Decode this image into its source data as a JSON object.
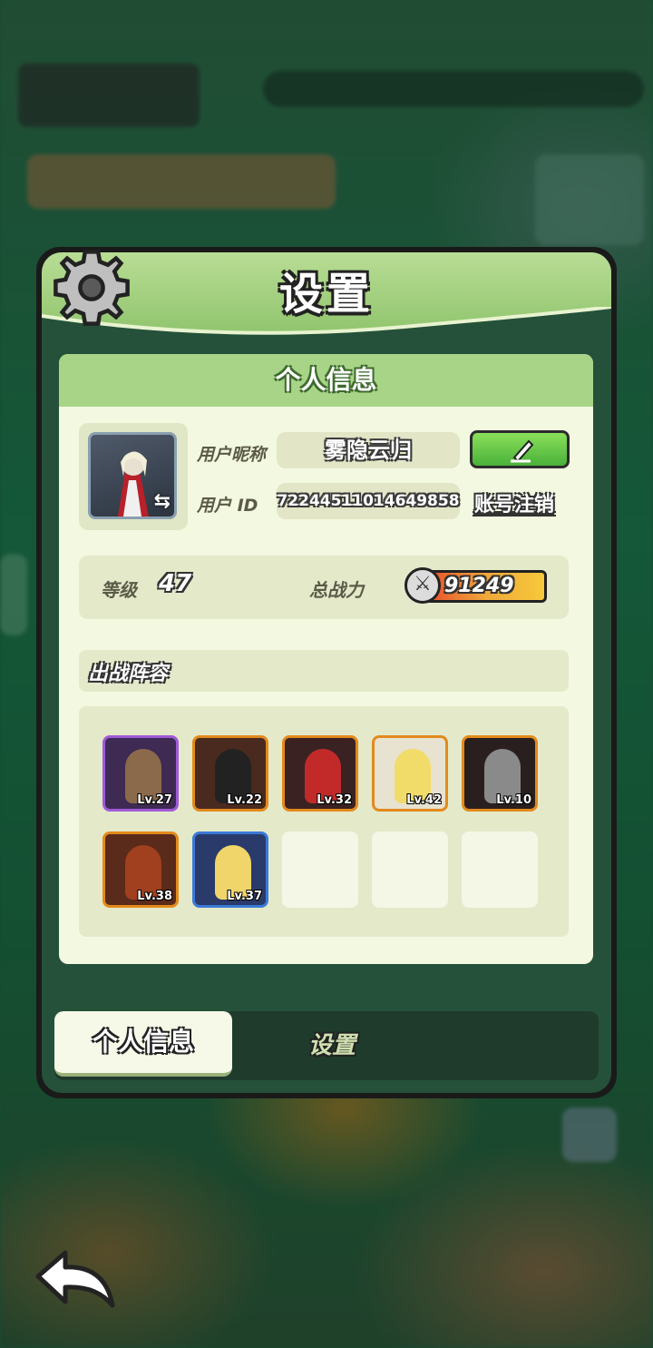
{
  "header": {
    "title": "设置"
  },
  "card": {
    "title": "个人信息",
    "nickname_label": "用户昵称",
    "nickname_value": "雾隐云归",
    "id_label": "用户  ID",
    "id_value": "72244511014649858",
    "cancel_account_label": "账号注销"
  },
  "stats": {
    "level_label": "等级",
    "level_value": "47",
    "power_label": "总战力",
    "power_value": "91249"
  },
  "lineup": {
    "title": "出战阵容",
    "heroes": [
      {
        "level": "Lv.27",
        "border": "#a05ad8"
      },
      {
        "level": "Lv.22",
        "border": "#e38a1c"
      },
      {
        "level": "Lv.32",
        "border": "#e38a1c"
      },
      {
        "level": "Lv.42",
        "border": "#e38a1c"
      },
      {
        "level": "Lv.10",
        "border": "#e38a1c"
      },
      {
        "level": "Lv.38",
        "border": "#e38a1c"
      },
      {
        "level": "Lv.37",
        "border": "#3a7ad8"
      }
    ],
    "empty_slots": 3
  },
  "tabs": {
    "active": "个人信息",
    "other": "设置"
  },
  "icons": {
    "settings": "gear-icon",
    "edit": "pencil-icon",
    "swap": "swap-arrows-icon",
    "power": "crossed-swords-icon",
    "back": "back-arrow-icon"
  },
  "colors": {
    "header_green": "#9fd17c",
    "card_bg": "#f3f8e0",
    "edit_button": "#5cc040",
    "epic_border": "#a05ad8",
    "legendary_border": "#e38a1c",
    "rare_border": "#3a7ad8"
  }
}
